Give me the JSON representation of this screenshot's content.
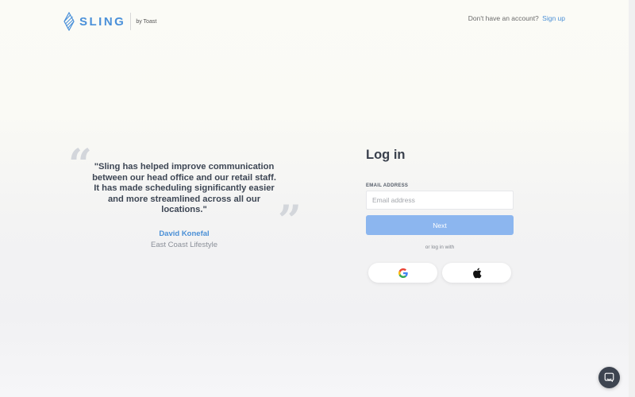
{
  "header": {
    "brand": "SLING",
    "brand_sub": "by Toast",
    "signup_prompt": "Don't have an account?",
    "signup_link": "Sign up"
  },
  "testimonial": {
    "quote": "\"Sling has helped improve communication between our head office and our retail staff. It has made scheduling significantly easier and more streamlined across all our locations.\"",
    "author": "David Konefal",
    "company": "East Coast Lifestyle"
  },
  "login": {
    "title": "Log in",
    "email_label": "EMAIL ADDRESS",
    "email_placeholder": "Email address",
    "email_value": "",
    "next_label": "Next",
    "alt_text": "or log in with"
  },
  "icons": {
    "google": "google-icon",
    "apple": "apple-icon",
    "chat": "chat-icon"
  },
  "colors": {
    "accent": "#4a90d9",
    "button": "#8cb6ef",
    "chat": "#3d4450"
  }
}
